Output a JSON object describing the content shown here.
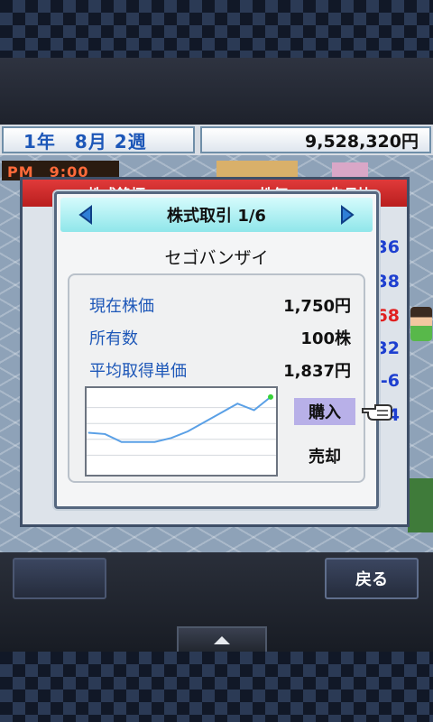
{
  "status": {
    "date": "1年　8月 2週",
    "money": "9,528,320円",
    "time": "PM　9:00"
  },
  "back_table": {
    "headers": [
      "株式銘柄",
      "株価",
      "先月比"
    ],
    "peek_values": [
      {
        "text": "36",
        "color": "#1d3fd0"
      },
      {
        "text": "38",
        "color": "#1d3fd0"
      },
      {
        "text": "68",
        "color": "#e02020"
      },
      {
        "text": "32",
        "color": "#1d3fd0"
      },
      {
        "text": "-6",
        "color": "#1d3fd0"
      },
      {
        "text": "4",
        "color": "#1d3fd0"
      }
    ]
  },
  "dialog": {
    "title": "株式取引 1/6",
    "stock_name": "セゴバンザイ",
    "rows": [
      {
        "label": "現在株価",
        "value": "1,750円"
      },
      {
        "label": "所有数",
        "value": "100株"
      },
      {
        "label": "平均取得単価",
        "value": "1,837円"
      }
    ],
    "buy_label": "購入",
    "sell_label": "売却"
  },
  "chart_data": {
    "type": "line",
    "x": [
      1,
      2,
      3,
      4,
      5,
      6,
      7,
      8,
      9,
      10,
      11,
      12
    ],
    "values": [
      58,
      56,
      44,
      44,
      44,
      50,
      60,
      74,
      88,
      102,
      92,
      112
    ],
    "title": "",
    "xlabel": "",
    "ylabel": "",
    "ylim": [
      0,
      120
    ],
    "grid": true,
    "line_color": "#5aa0e6",
    "marker_color": "#38d338"
  },
  "footer": {
    "back_label": "戻る"
  },
  "icons": {
    "prev": "left-arrow-icon",
    "next": "right-arrow-icon",
    "pointer": "pointing-hand-icon",
    "up": "up-arrow-icon"
  }
}
